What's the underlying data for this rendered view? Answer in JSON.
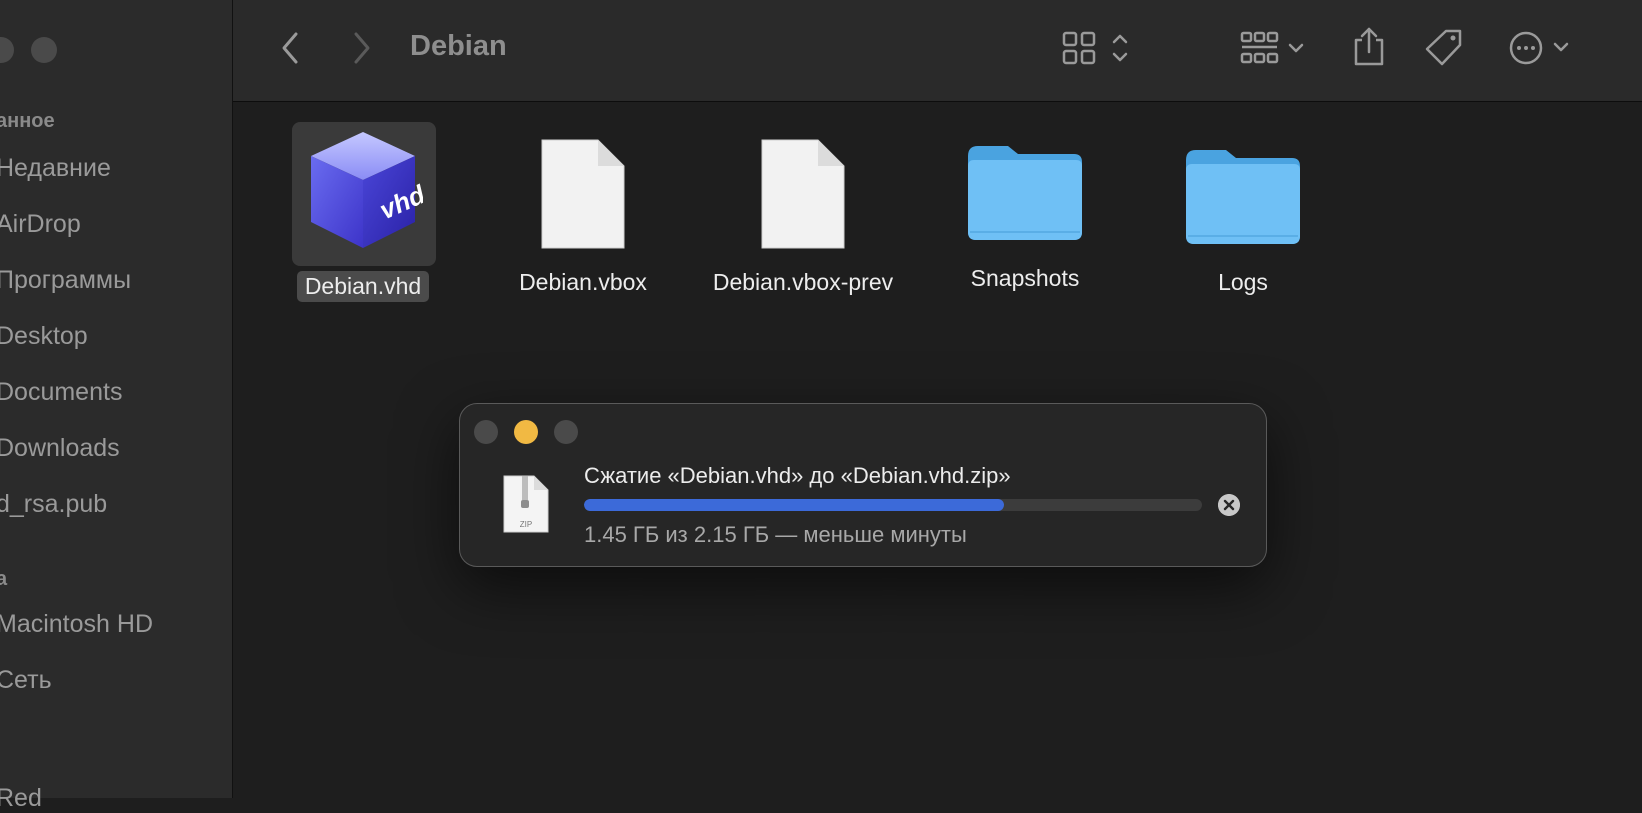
{
  "sidebar": {
    "favorites_header": "анное",
    "favorites": [
      "Недавние",
      "AirDrop",
      "Программы",
      "Desktop",
      "Documents",
      "Downloads",
      "d_rsa.pub"
    ],
    "locations_header": "a",
    "locations": [
      "Macintosh HD",
      "Сеть"
    ],
    "tags_partial": "Red"
  },
  "toolbar": {
    "title": "Debian",
    "icons": [
      "back-icon",
      "forward-icon",
      "icon-view-icon",
      "group-icon",
      "share-icon",
      "tag-icon",
      "more-icon"
    ]
  },
  "files": [
    {
      "name": "Debian.vhd",
      "kind": "vhd",
      "selected": true
    },
    {
      "name": "Debian.vbox",
      "kind": "document"
    },
    {
      "name": "Debian.vbox-prev",
      "kind": "document"
    },
    {
      "name": "Snapshots",
      "kind": "folder"
    },
    {
      "name": "Logs",
      "kind": "folder"
    }
  ],
  "vhd_badge": "vhd",
  "dialog": {
    "title": "Сжатие «Debian.vhd» до «Debian.vhd.zip»",
    "status": "1.45 ГБ из 2.15 ГБ — меньше минуты",
    "progress_fraction": 0.68,
    "zip_label": "ZIP"
  },
  "colors": {
    "accent": "#3c6ad9",
    "folder": "#6fc0f5",
    "minimize": "#f1b943"
  }
}
